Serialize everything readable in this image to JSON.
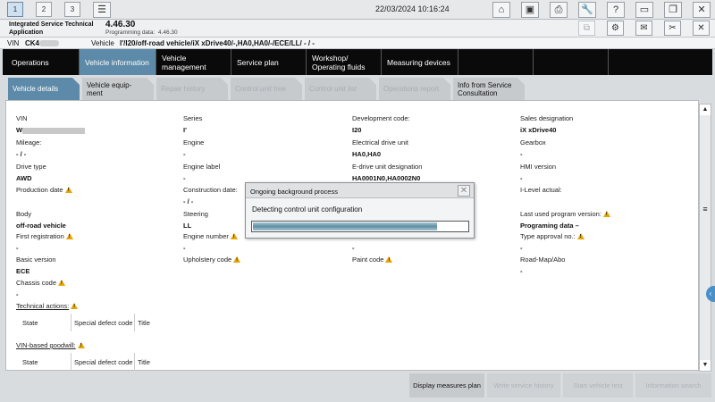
{
  "topbar": {
    "windows": [
      "1",
      "2",
      "3"
    ],
    "datetime": "22/03/2024 10:16:24"
  },
  "app": {
    "name_line1": "Integrated Service Technical",
    "name_line2": "Application",
    "version": "4.46.30",
    "programming_data_label": "Programming data:",
    "programming_data_value": "4.46.30"
  },
  "vin_line": {
    "vin_label": "VIN",
    "vin_value": "CK4",
    "vehicle_label": "Vehicle",
    "vehicle_value": "I'/I20/off-road vehicle/iX xDrive40/-,HA0,HA0/-/ECE/LL/ - / -"
  },
  "main_tabs": [
    {
      "label": "Operations"
    },
    {
      "label": "Vehicle information"
    },
    {
      "label": "Vehicle management"
    },
    {
      "label": "Service plan"
    },
    {
      "label": "Workshop/ Operating fluids"
    },
    {
      "label": "Measuring devices"
    }
  ],
  "sub_tabs": [
    {
      "label": "Vehicle details"
    },
    {
      "label": "Vehicle equip- ment"
    },
    {
      "label": "Repair history"
    },
    {
      "label": "Control unit tree"
    },
    {
      "label": "Control unit list"
    },
    {
      "label": "Operations report"
    },
    {
      "label": "Info from Service Consultation"
    }
  ],
  "fields": {
    "vin": {
      "label": "VIN",
      "value": "W"
    },
    "series": {
      "label": "Series",
      "value": "I'"
    },
    "development_code": {
      "label": "Development code:",
      "value": "I20"
    },
    "sales_designation": {
      "label": "Sales designation",
      "value": "iX xDrive40"
    },
    "mileage": {
      "label": "Mileage:",
      "value": "- / -"
    },
    "engine": {
      "label": "Engine",
      "value": "-"
    },
    "electrical_drive_unit": {
      "label": "Electrical drive unit",
      "value": "HA0,HA0"
    },
    "gearbox": {
      "label": "Gearbox",
      "value": "-"
    },
    "drive_type": {
      "label": "Drive type",
      "value": "AWD"
    },
    "engine_label": {
      "label": "Engine label",
      "value": "-"
    },
    "edrive_unit_designation": {
      "label": "E-drive unit designation",
      "value": "HA0001N0,HA0002N0"
    },
    "hmi_version": {
      "label": "HMI version",
      "value": "-"
    },
    "production_date": {
      "label": "Production date",
      "value": ""
    },
    "construction_date": {
      "label": "Construction date:",
      "value": "- / -"
    },
    "ilevel_actual": {
      "label": "I-Level actual:",
      "value": ""
    },
    "body": {
      "label": "Body",
      "value": "off-road vehicle"
    },
    "steering": {
      "label": "Steering",
      "value": "LL"
    },
    "last_used_program_version": {
      "label": "Last used program version:",
      "value": "Programing data –"
    },
    "first_registration": {
      "label": "First registration",
      "value": "-"
    },
    "engine_number": {
      "label": "Engine number",
      "value": "-"
    },
    "col3_row6": {
      "value": "-"
    },
    "type_approval_no": {
      "label": "Type approval no.:",
      "value": "-"
    },
    "basic_version": {
      "label": "Basic version",
      "value": "ECE"
    },
    "upholstery_code": {
      "label": "Upholstery code",
      "value": ""
    },
    "paint_code": {
      "label": "Paint code",
      "value": ""
    },
    "roadmap_abo": {
      "label": "Road-Map/Abo",
      "value": "-"
    },
    "chassis_code": {
      "label": "Chassis code",
      "value": "-"
    }
  },
  "technical_actions": {
    "label": "Technical actions:",
    "columns": [
      "State",
      "Special defect code",
      "Title"
    ]
  },
  "vin_goodwill": {
    "label": "VIN-based goodwill:",
    "columns": [
      "State",
      "Special defect code",
      "Title"
    ]
  },
  "bottom_buttons": [
    {
      "label": "Display measures plan",
      "enabled": true
    },
    {
      "label": "Write service history",
      "enabled": false
    },
    {
      "label": "Start vehicle test",
      "enabled": false
    },
    {
      "label": "Information search",
      "enabled": false
    }
  ],
  "dialog": {
    "title": "Ongoing background process",
    "message": "Detecting control unit configuration",
    "progress": 0.86
  },
  "icons": {
    "home": "home-icon",
    "accent": "#5d8aa8",
    "warning": "#e8a400"
  }
}
